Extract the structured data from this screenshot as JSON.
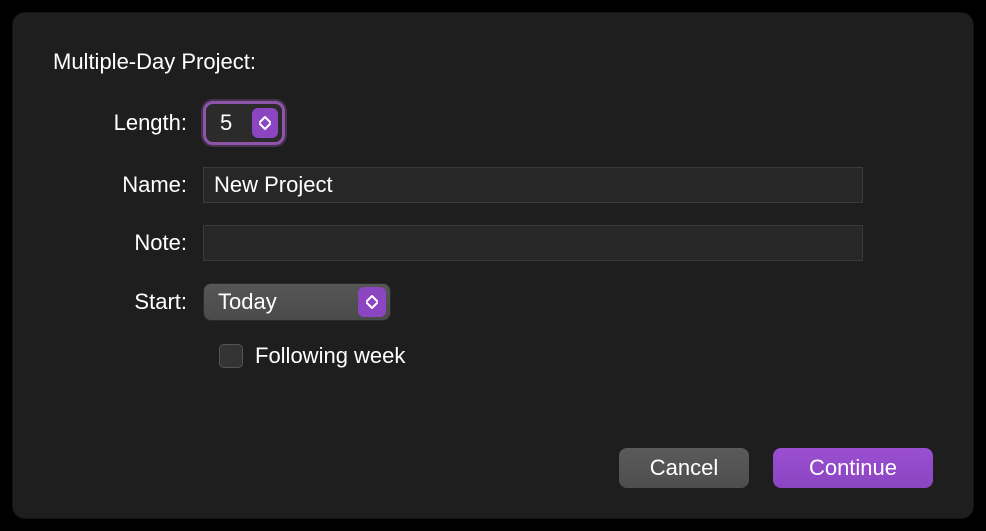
{
  "dialog": {
    "title": "Multiple-Day Project:",
    "length_label": "Length:",
    "length_value": "5",
    "name_label": "Name:",
    "name_value": "New Project",
    "note_label": "Note:",
    "note_value": "",
    "start_label": "Start:",
    "start_value": "Today",
    "following_week_label": "Following week",
    "following_week_checked": false,
    "cancel_label": "Cancel",
    "continue_label": "Continue",
    "accent_color": "#8b45c1"
  }
}
